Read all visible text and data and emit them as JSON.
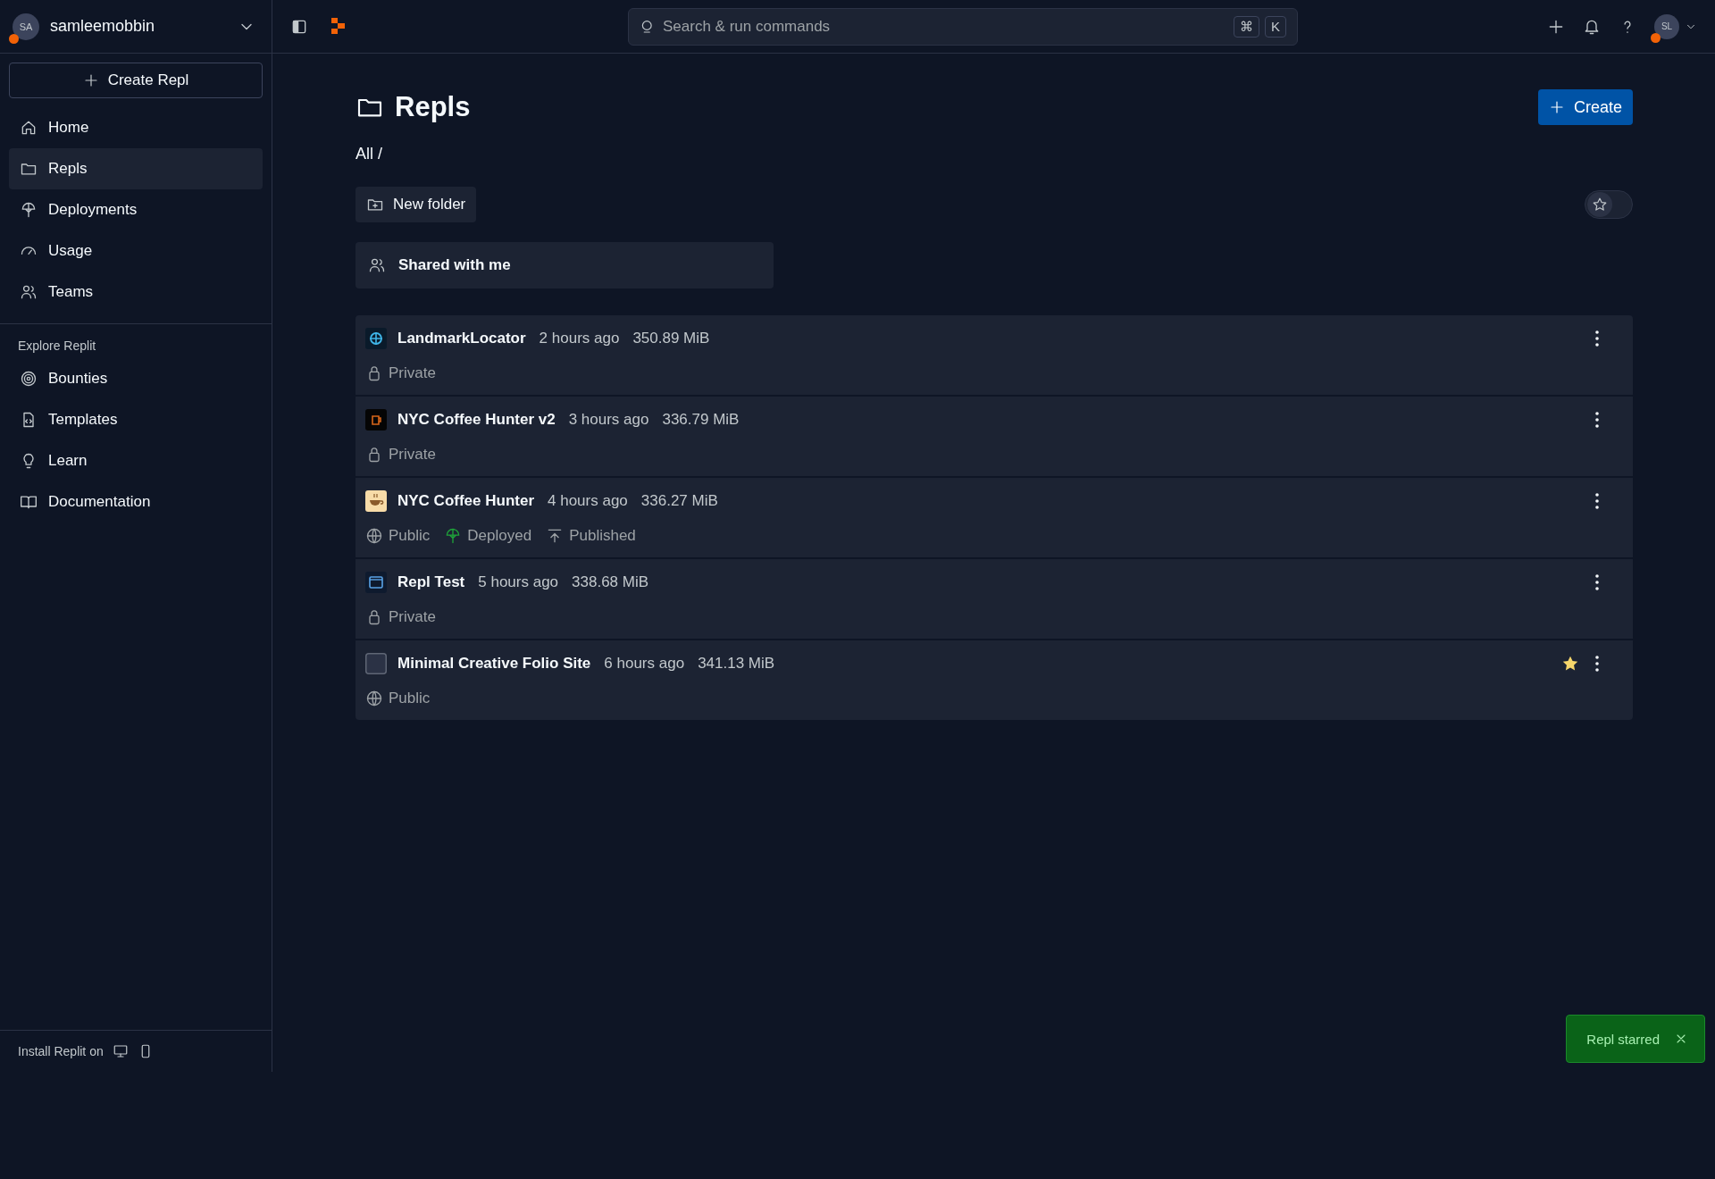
{
  "account": {
    "initials": "SA",
    "username": "samleemobbin"
  },
  "create_repl": "Create Repl",
  "nav": [
    {
      "label": "Home",
      "selected": false
    },
    {
      "label": "Repls",
      "selected": true
    },
    {
      "label": "Deployments",
      "selected": false
    },
    {
      "label": "Usage",
      "selected": false
    },
    {
      "label": "Teams",
      "selected": false
    }
  ],
  "explore": {
    "heading": "Explore Replit",
    "items": [
      {
        "label": "Bounties"
      },
      {
        "label": "Templates"
      },
      {
        "label": "Learn"
      },
      {
        "label": "Documentation"
      }
    ]
  },
  "install": "Install Replit on",
  "search": {
    "placeholder": "Search & run commands",
    "keys": [
      "⌘",
      "K"
    ]
  },
  "user_initials": "SL",
  "page": {
    "title": "Repls",
    "create": "Create",
    "breadcrumb": "All /",
    "new_folder": "New folder",
    "favorites_toggle": {
      "on": false
    },
    "shared": "Shared with me"
  },
  "repls": [
    {
      "name": "LandmarkLocator",
      "time": "2 hours ago",
      "size": "350.89 MiB",
      "starred": false,
      "tags": [
        {
          "kind": "private",
          "label": "Private"
        }
      ]
    },
    {
      "name": "NYC Coffee Hunter v2",
      "time": "3 hours ago",
      "size": "336.79 MiB",
      "starred": false,
      "tags": [
        {
          "kind": "private",
          "label": "Private"
        }
      ]
    },
    {
      "name": "NYC Coffee Hunter",
      "time": "4 hours ago",
      "size": "336.27 MiB",
      "starred": false,
      "tags": [
        {
          "kind": "public",
          "label": "Public"
        },
        {
          "kind": "deployed",
          "label": "Deployed"
        },
        {
          "kind": "published",
          "label": "Published"
        }
      ]
    },
    {
      "name": "Repl Test",
      "time": "5 hours ago",
      "size": "338.68 MiB",
      "starred": false,
      "tags": [
        {
          "kind": "private",
          "label": "Private"
        }
      ]
    },
    {
      "name": "Minimal Creative Folio Site",
      "time": "6 hours ago",
      "size": "341.13 MiB",
      "starred": true,
      "tags": [
        {
          "kind": "public",
          "label": "Public"
        }
      ]
    }
  ],
  "toast": "Repl starred"
}
